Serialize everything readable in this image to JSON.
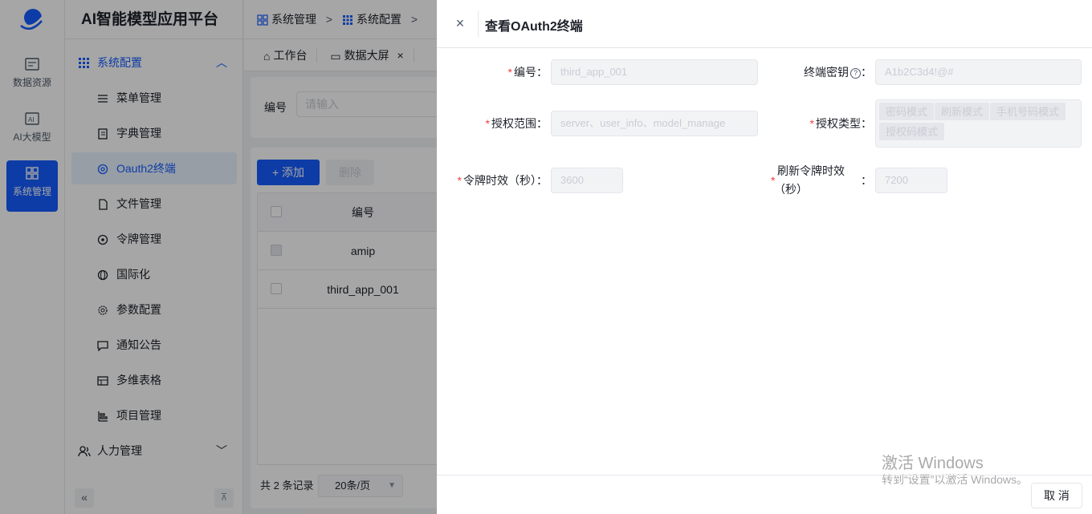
{
  "rail": {
    "items": [
      {
        "label": "数据资源",
        "icon": "data-resource-icon"
      },
      {
        "label": "AI大模型",
        "icon": "ai-model-icon"
      },
      {
        "label": "系统管理",
        "icon": "system-icon"
      }
    ]
  },
  "sidebar": {
    "brand": "AI智能模型应用平台",
    "group_label": "系统配置",
    "items": [
      {
        "label": "菜单管理",
        "icon": "menu-list-icon"
      },
      {
        "label": "字典管理",
        "icon": "dictionary-icon"
      },
      {
        "label": "Oauth2终端",
        "icon": "oauth-icon"
      },
      {
        "label": "文件管理",
        "icon": "file-icon"
      },
      {
        "label": "令牌管理",
        "icon": "token-icon"
      },
      {
        "label": "国际化",
        "icon": "globe-icon"
      },
      {
        "label": "参数配置",
        "icon": "settings-icon"
      },
      {
        "label": "通知公告",
        "icon": "notice-icon"
      },
      {
        "label": "多维表格",
        "icon": "table-icon"
      },
      {
        "label": "项目管理",
        "icon": "project-icon"
      }
    ],
    "group2_label": "人力管理"
  },
  "breadcrumb": {
    "items": [
      "系统管理",
      "系统配置"
    ],
    "separator": ">"
  },
  "tabs": {
    "workbench": "工作台",
    "dashboard": "数据大屏",
    "close": "×"
  },
  "search": {
    "label": "编号",
    "placeholder": "请输入"
  },
  "toolbar": {
    "add_label": "+ 添加",
    "delete_label": "删除"
  },
  "table": {
    "header": "编号",
    "rows": [
      "amip",
      "third_app_001"
    ]
  },
  "pagination": {
    "total": "共 2 条记录",
    "page_size": "20条/页",
    "caret": "▼"
  },
  "drawer": {
    "close": "×",
    "title": "查看OAuth2终端",
    "client_id_label": "编号",
    "client_id_value": "third_app_001",
    "secret_label": "终端密钥",
    "secret_value": "A1b2C3d4!@#",
    "scope_label": "授权范围",
    "scope_value": "server、user_info、model_manage",
    "grant_label": "授权类型",
    "grant_types": [
      "密码模式",
      "刷新模式",
      "手机号码模式",
      "授权码模式"
    ],
    "token_label": "令牌时效（秒）",
    "token_value": "3600",
    "refresh_label_line1": "刷新令牌时效",
    "refresh_label_line2": "（秒）",
    "refresh_value": "7200",
    "colon": "：",
    "required_mark": "*",
    "help_mark": "?",
    "cancel_label": "取 消"
  },
  "watermark": {
    "line1": "激活 Windows",
    "line2": "转到“设置”以激活 Windows。"
  },
  "colors": {
    "primary": "#165dff",
    "required": "#f53f3f"
  }
}
